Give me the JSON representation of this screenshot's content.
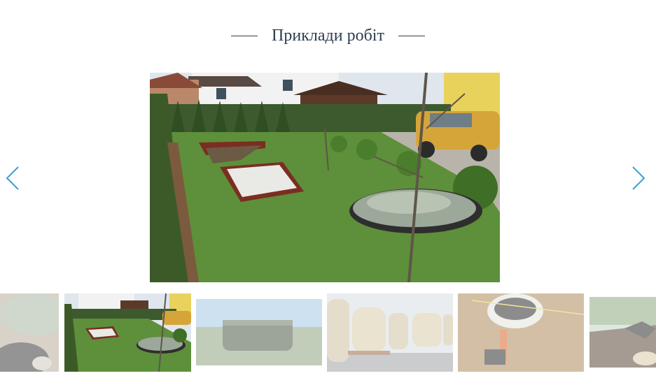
{
  "section": {
    "title": "Приклади робіт"
  },
  "gallery": {
    "active_index": 1,
    "thumbnails": [
      {
        "name": "thumb-tank-closeup",
        "active": false
      },
      {
        "name": "thumb-garden-septic",
        "active": true
      },
      {
        "name": "thumb-long-tank-field",
        "active": false
      },
      {
        "name": "thumb-tank-rows-warehouse",
        "active": false
      },
      {
        "name": "thumb-tank-installation-soil",
        "active": false
      },
      {
        "name": "thumb-excavation-site",
        "active": false
      }
    ]
  },
  "colors": {
    "title": "#2e3e4e",
    "arrow": "#3aa0d8",
    "grass": "#5e8f3a"
  },
  "icons": {
    "prev": "chevron-left-icon",
    "next": "chevron-right-icon"
  }
}
